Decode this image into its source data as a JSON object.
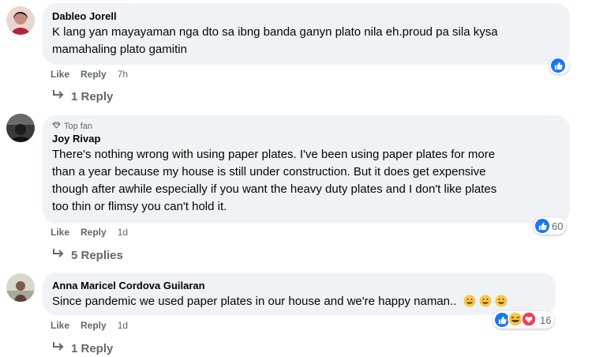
{
  "comments": [
    {
      "author": "Dableo Jorell",
      "text_line1": "K lang yan mayayaman nga dto sa ibng banda ganyn plato nila eh.proud pa sila kysa",
      "text_line2": "mamahaling plato gamitin",
      "like": "Like",
      "reply": "Reply",
      "time": "7h",
      "replies": "1 Reply",
      "reactions": {
        "types": [
          "like"
        ],
        "count": ""
      }
    },
    {
      "badge": "Top fan",
      "author": "Joy Rivap",
      "text_line1": "There's nothing wrong with using paper plates. I've been using paper plates for more",
      "text_line2": "than a year because my house is still under construction. But it does get expensive",
      "text_line3": "though after awhile especially if you want the heavy duty plates and I don't like plates",
      "text_line4": "too thin or flimsy you can't hold it.",
      "like": "Like",
      "reply": "Reply",
      "time": "1d",
      "replies": "5 Replies",
      "reactions": {
        "types": [
          "like"
        ],
        "count": "60"
      }
    },
    {
      "author": "Anna Maricel Cordova Guilaran",
      "text_line1": "Since pandemic we used paper plates in our house and we're happy naman..",
      "like": "Like",
      "reply": "Reply",
      "time": "1d",
      "replies": "1 Reply",
      "reactions": {
        "types": [
          "like",
          "haha",
          "love"
        ],
        "count": "16"
      }
    }
  ],
  "colors": {
    "like_blue": "#1877f2",
    "bubble": "#f0f2f5",
    "meta": "#65676b",
    "love_red": "#f33e58",
    "haha_yellow": "#f7c64a"
  }
}
